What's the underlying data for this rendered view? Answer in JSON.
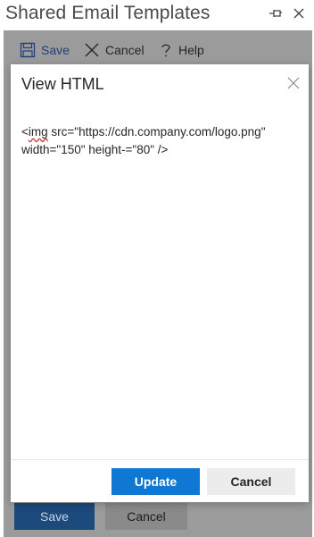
{
  "pane": {
    "title": "Shared Email Templates",
    "pin_icon": "pin-icon",
    "close_icon": "close-icon"
  },
  "toolbar": {
    "save_label": "Save",
    "cancel_label": "Cancel",
    "help_label": "Help",
    "icons": [
      "save-icon",
      "cancel-x-icon",
      "help-question-icon"
    ]
  },
  "background_buttons": {
    "save_label": "Save",
    "cancel_label": "Cancel"
  },
  "dialog": {
    "title": "View HTML",
    "html_prefix": "<",
    "html_tag": "img",
    "html_rest": " src=\"https://cdn.company.com/logo.png\" width=\"150\" height-=\"80\" />",
    "update_label": "Update",
    "cancel_label": "Cancel"
  },
  "colors": {
    "primary": "#0f78d4",
    "overlay": "#9b9b9b",
    "secondary_button": "#ececec",
    "spell_error": "#d23a3a"
  }
}
